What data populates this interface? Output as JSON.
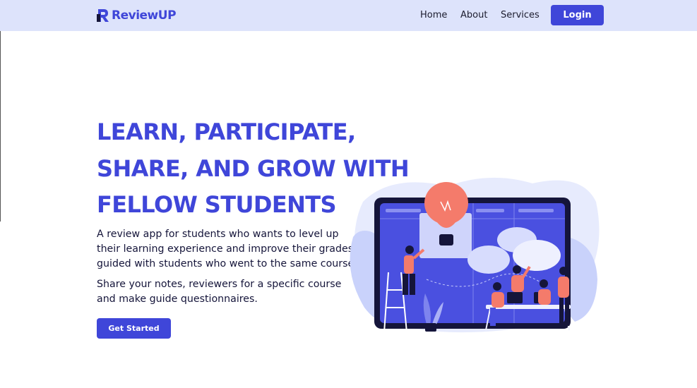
{
  "brand": {
    "name": "ReviewUP",
    "color": "#3f46d9",
    "nav_bg": "#dde3fb"
  },
  "nav": {
    "home": "Home",
    "about": "About",
    "services": "Services",
    "login": "Login"
  },
  "hero": {
    "title_lines": [
      "LEARN, PARTICIPATE,",
      "SHARE, AND GROW WITH",
      "FELLOW STUDENTS"
    ],
    "description": "A review app for students who wants to level up their learning experience and improve their grades guided with students who went to the same course.",
    "description2": "Share your notes, reviewers for a specific course and make guide questionnaires.",
    "cta": "Get Started",
    "illustration": "students-collaborating-illustration"
  }
}
